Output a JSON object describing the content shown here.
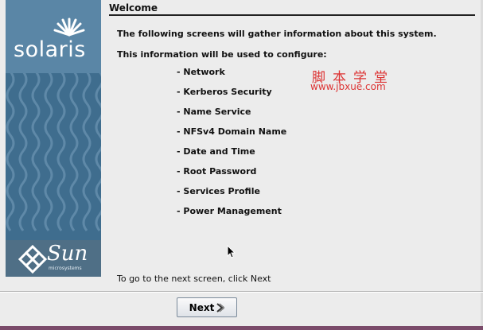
{
  "header": {
    "title": "Welcome"
  },
  "sidebar": {
    "logo_text": "solaris",
    "sun_logo_text": "Sun",
    "sun_logo_subtext": "microsystems"
  },
  "main": {
    "intro_1": "The following screens will gather information about this system.",
    "intro_2": "This information will be used to configure:",
    "items": [
      "- Network",
      "- Kerberos Security",
      "- Name Service",
      "- NFSv4 Domain Name",
      "- Date and Time",
      "- Root Password",
      "- Services Profile",
      "- Power Management"
    ],
    "footer_text": "To go to the next screen, click Next"
  },
  "watermark": {
    "text": "脚本学堂",
    "url": "www.jbxue.com"
  },
  "buttons": {
    "next_label": "Next"
  },
  "colors": {
    "sidebar": "#3f6d8e",
    "watermark": "#dd3333",
    "background": "#ececec"
  }
}
